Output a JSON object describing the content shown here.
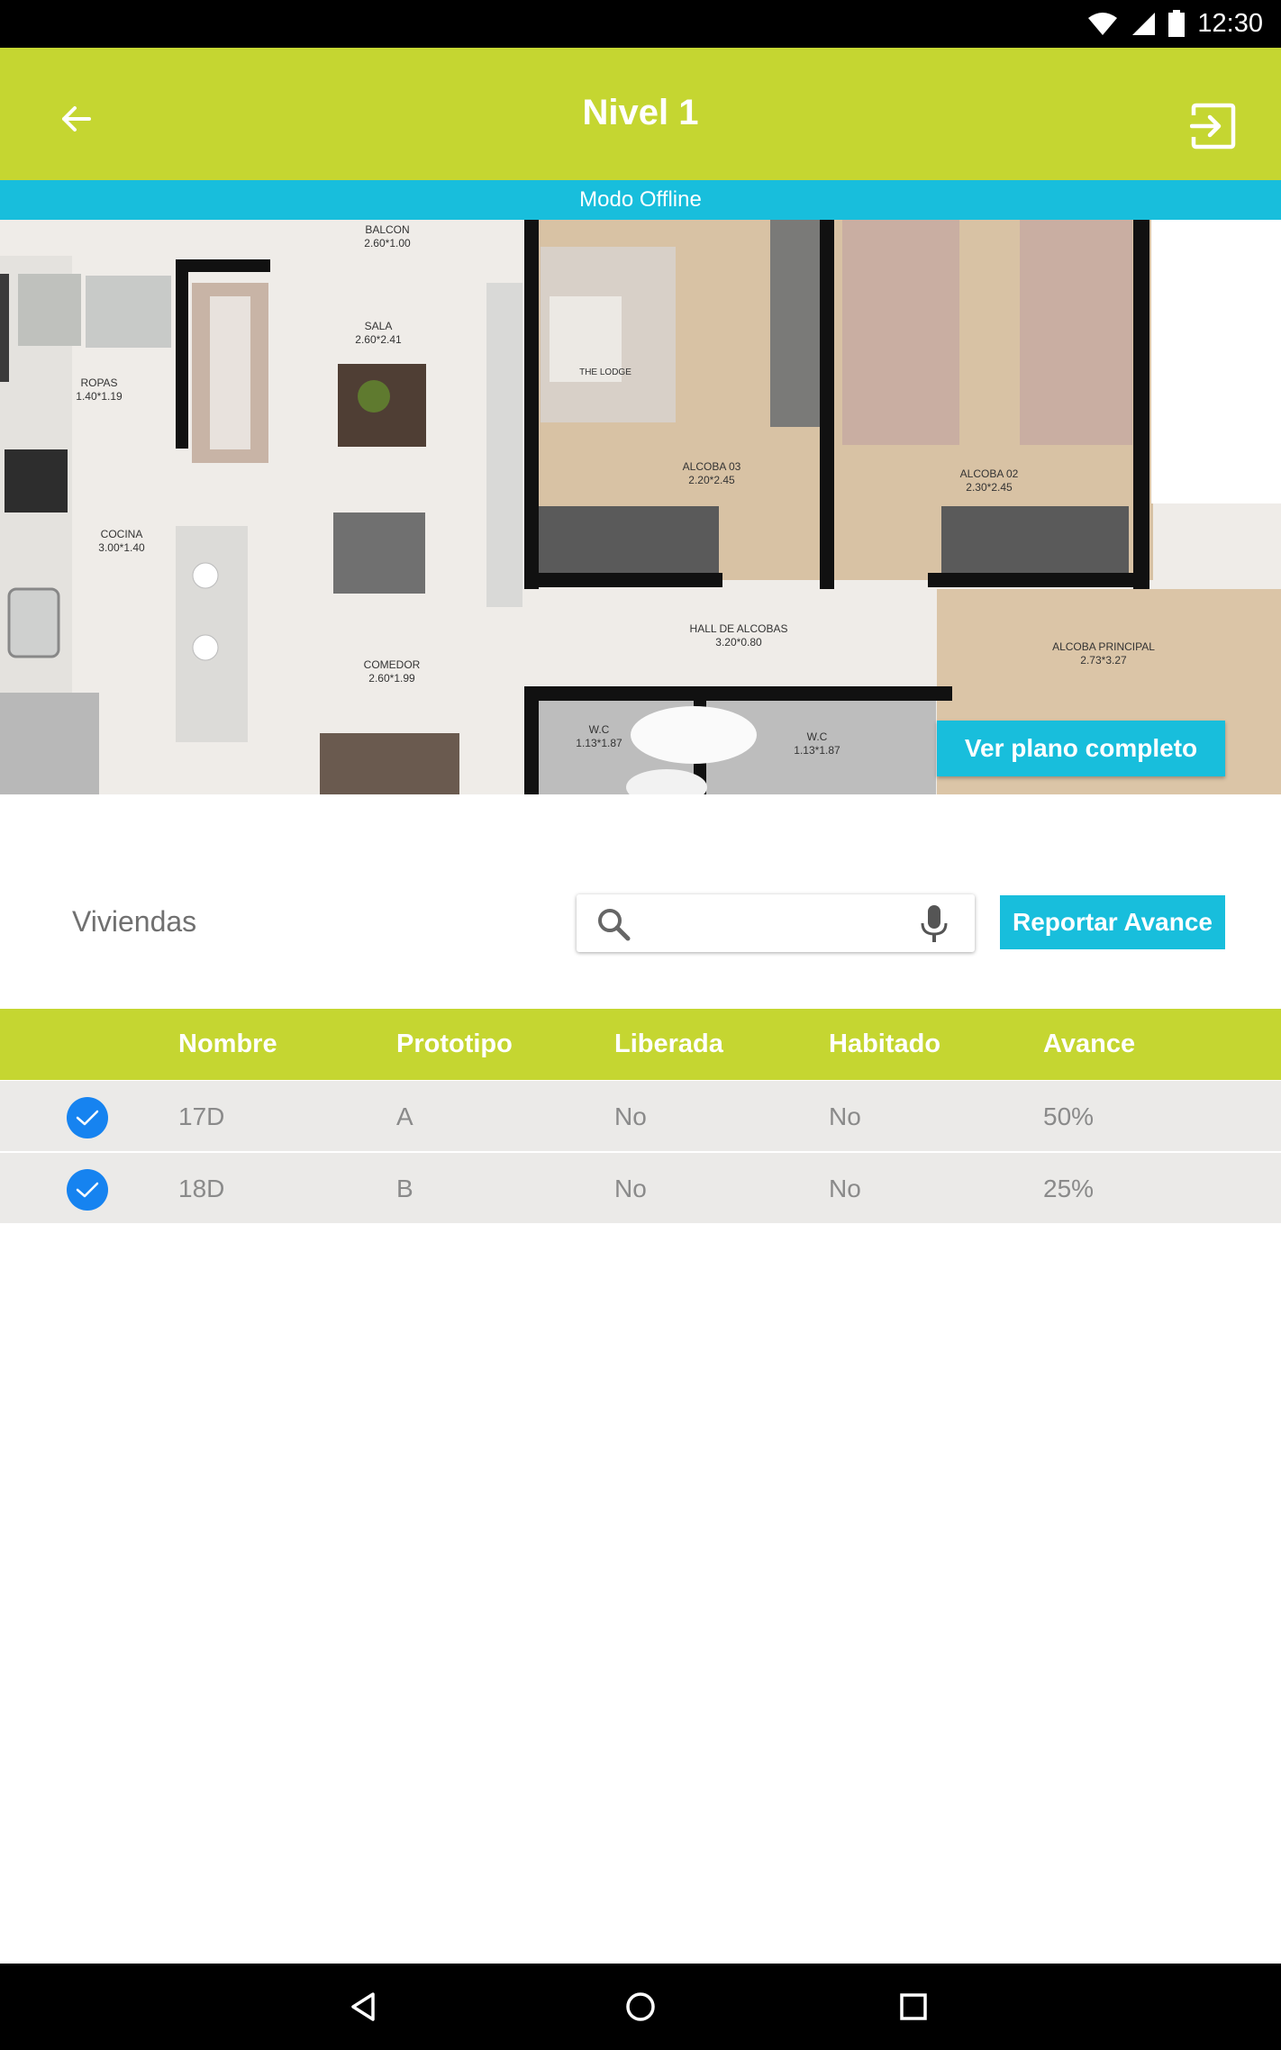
{
  "status_bar": {
    "time": "12:30",
    "icons": [
      "wifi-icon",
      "signal-icon",
      "battery-icon"
    ]
  },
  "app_bar": {
    "title": "Nivel 1",
    "back_icon": "arrow-left-icon",
    "exit_icon": "exit-to-app-icon",
    "color": "#c5d631"
  },
  "offline_banner": {
    "text": "Modo Offline",
    "color": "#18bedc"
  },
  "floor_plan": {
    "rooms": [
      {
        "name": "BALCON",
        "size": "2.60*1.00"
      },
      {
        "name": "SALA",
        "size": "2.60*2.41"
      },
      {
        "name": "ROPAS",
        "size": "1.40*1.19"
      },
      {
        "name": "COCINA",
        "size": "3.00*1.40"
      },
      {
        "name": "COMEDOR",
        "size": "2.60*1.99"
      },
      {
        "name": "ALCOBA 03",
        "size": "2.20*2.45"
      },
      {
        "name": "ALCOBA 02",
        "size": "2.30*2.45"
      },
      {
        "name": "HALL DE ALCOBAS",
        "size": "3.20*0.80"
      },
      {
        "name": "ALCOBA PRINCIPAL",
        "size": "2.73*3.27"
      },
      {
        "name": "W.C",
        "size": "1.13*1.87"
      },
      {
        "name": "W.C",
        "size": "1.13*1.87"
      }
    ],
    "poster_text": "THE LODGE",
    "view_button_label": "Ver plano completo"
  },
  "viviendas": {
    "label": "Viviendas",
    "search_placeholder": "",
    "report_button_label": "Reportar Avance"
  },
  "table": {
    "columns": [
      "Nombre",
      "Prototipo",
      "Liberada",
      "Habitado",
      "Avance"
    ],
    "rows": [
      {
        "checked": true,
        "nombre": "17D",
        "prototipo": "A",
        "liberada": "No",
        "habitado": "No",
        "avance": "50%"
      },
      {
        "checked": true,
        "nombre": "18D",
        "prototipo": "B",
        "liberada": "No",
        "habitado": "No",
        "avance": "25%"
      }
    ]
  },
  "nav_bar": {
    "icons": [
      "back-triangle-icon",
      "home-circle-icon",
      "recents-square-icon"
    ]
  }
}
